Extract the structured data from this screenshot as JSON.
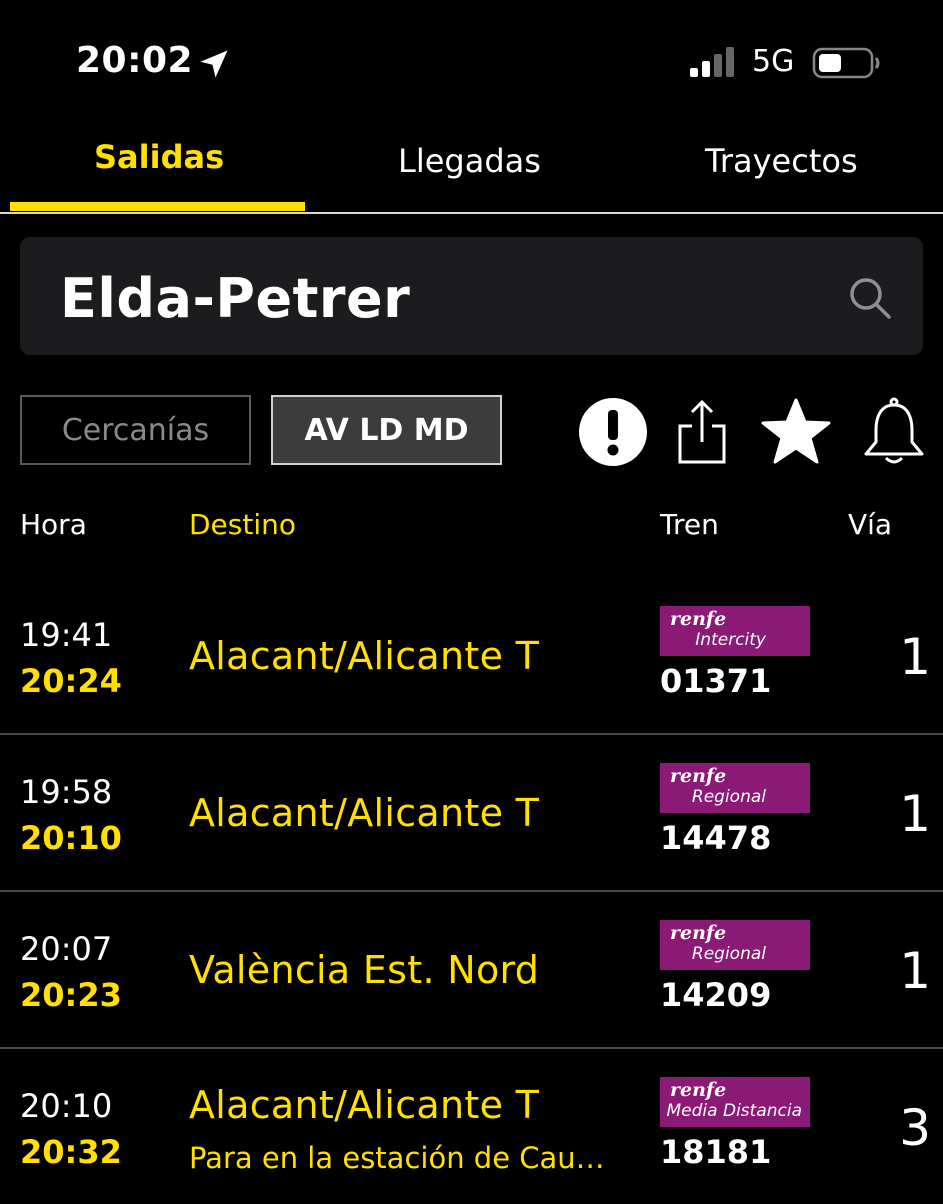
{
  "status_bar": {
    "time": "20:02",
    "network": "5G"
  },
  "tabs": [
    {
      "label": "Salidas"
    },
    {
      "label": "Llegadas"
    },
    {
      "label": "Trayectos"
    }
  ],
  "search": {
    "value": "Elda-Petrer"
  },
  "filters": [
    {
      "label": "Cercanías"
    },
    {
      "label": "AV LD MD"
    }
  ],
  "columns": {
    "hora": "Hora",
    "destino": "Destino",
    "tren": "Tren",
    "via": "Vía"
  },
  "departures": [
    {
      "scheduled": "19:41",
      "estimated": "20:24",
      "destination": "Alacant/Alicante T",
      "note": "",
      "brand": "renfe",
      "service": "Intercity",
      "train": "01371",
      "platform": "1"
    },
    {
      "scheduled": "19:58",
      "estimated": "20:10",
      "destination": "Alacant/Alicante T",
      "note": "",
      "brand": "renfe",
      "service": "Regional",
      "train": "14478",
      "platform": "1"
    },
    {
      "scheduled": "20:07",
      "estimated": "20:23",
      "destination": "València Est. Nord",
      "note": "",
      "brand": "renfe",
      "service": "Regional",
      "train": "14209",
      "platform": "1"
    },
    {
      "scheduled": "20:10",
      "estimated": "20:32",
      "destination": "Alacant/Alicante T",
      "note": "Para en la estación de Cau…",
      "brand": "renfe",
      "service": "Media Distancia",
      "train": "18181",
      "platform": "3"
    }
  ],
  "colors": {
    "accent": "#ffe000",
    "badge": "#8a1a76",
    "background": "#000000",
    "search_bg": "#1c1c1e"
  },
  "icons": [
    "location-arrow-icon",
    "signal-icon",
    "battery-icon",
    "search-icon",
    "alert-icon",
    "share-icon",
    "star-icon",
    "bell-icon"
  ]
}
